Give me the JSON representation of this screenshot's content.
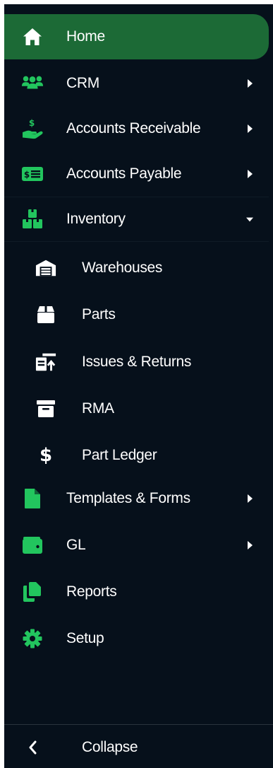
{
  "sidebar": {
    "items": [
      {
        "label": "Home",
        "icon": "home-icon",
        "active": true
      },
      {
        "label": "CRM",
        "icon": "users-icon",
        "has_submenu": true
      },
      {
        "label": "Accounts Receivable",
        "icon": "hand-coin-icon",
        "has_submenu": true
      },
      {
        "label": "Accounts Payable",
        "icon": "money-bill-icon",
        "has_submenu": true
      },
      {
        "label": "Inventory",
        "icon": "boxes-icon",
        "has_submenu": true,
        "expanded": true
      }
    ],
    "inventory_children": [
      {
        "label": "Warehouses",
        "icon": "warehouse-icon"
      },
      {
        "label": "Parts",
        "icon": "box-icon"
      },
      {
        "label": "Issues & Returns",
        "icon": "issue-return-icon"
      },
      {
        "label": "RMA",
        "icon": "archive-icon"
      },
      {
        "label": "Part Ledger",
        "icon": "dollar-icon",
        "glyph": "$"
      }
    ],
    "items_after": [
      {
        "label": "Templates & Forms",
        "icon": "file-icon",
        "has_submenu": true
      },
      {
        "label": "GL",
        "icon": "wallet-icon",
        "has_submenu": true
      },
      {
        "label": "Reports",
        "icon": "copy-icon"
      },
      {
        "label": "Setup",
        "icon": "gear-icon"
      }
    ],
    "collapse_label": "Collapse",
    "collapse_icon": "chevron-left-icon"
  },
  "colors": {
    "background": "#06101b",
    "active_background": "#1c6a36",
    "icon_green": "#22c55e",
    "text": "#ffffff"
  }
}
